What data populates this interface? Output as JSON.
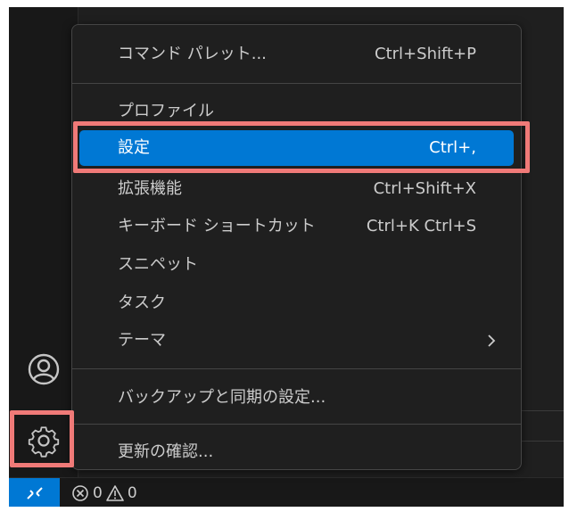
{
  "menu": {
    "items": [
      {
        "label": "コマンド パレット...",
        "shortcut": "Ctrl+Shift+P"
      },
      {
        "label": "プロファイル",
        "shortcut": ""
      },
      {
        "label": "設定",
        "shortcut": "Ctrl+,"
      },
      {
        "label": "拡張機能",
        "shortcut": "Ctrl+Shift+X"
      },
      {
        "label": "キーボード ショートカット",
        "shortcut": "Ctrl+K Ctrl+S"
      },
      {
        "label": "スニペット",
        "shortcut": ""
      },
      {
        "label": "タスク",
        "shortcut": ""
      },
      {
        "label": "テーマ",
        "shortcut": ""
      },
      {
        "label": "バックアップと同期の設定...",
        "shortcut": ""
      },
      {
        "label": "更新の確認...",
        "shortcut": ""
      }
    ],
    "selected_label": "設定"
  },
  "status_bar": {
    "errors": "0",
    "warnings": "0"
  },
  "icons": {
    "account": "account-icon",
    "manage": "gear-icon",
    "remote": "remote-icon",
    "error": "error-icon",
    "warning": "warning-icon",
    "submenu": "chevron-right-icon"
  },
  "colors": {
    "accent": "#0078d4",
    "highlight_box": "#f07a78",
    "menu_background": "#1f1f1f",
    "text": "#cccccc"
  }
}
